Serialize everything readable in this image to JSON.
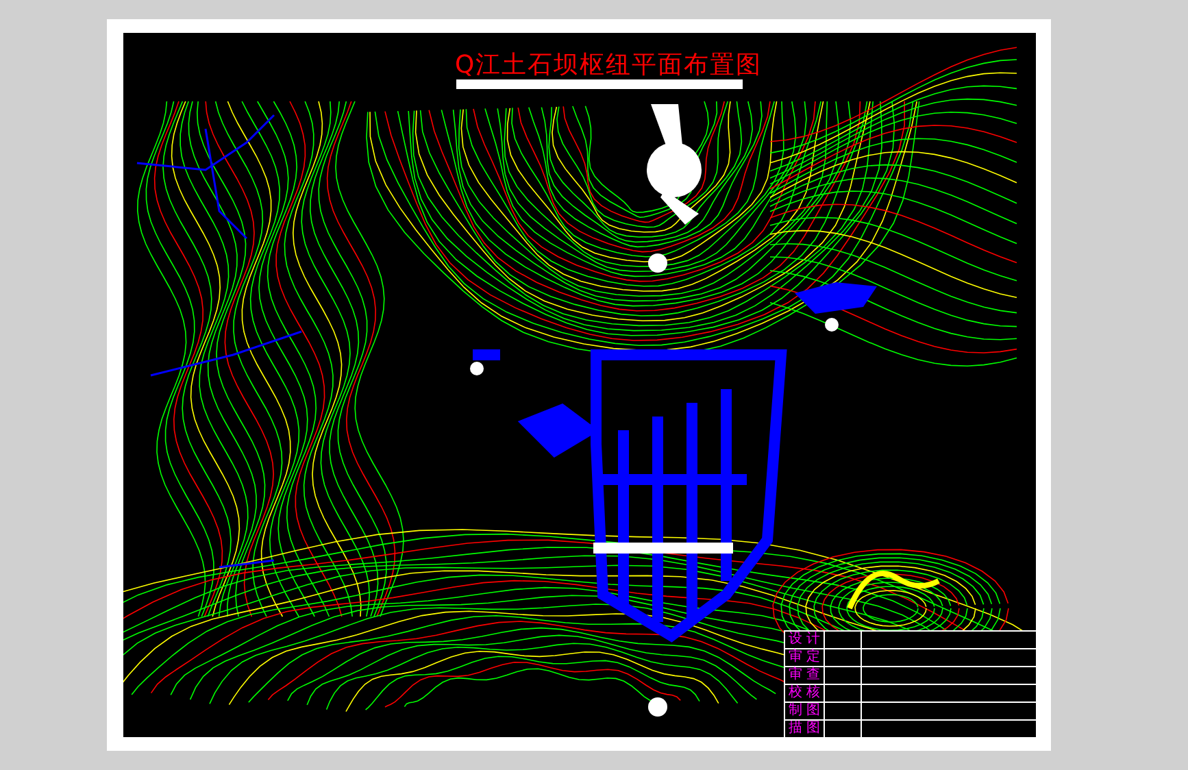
{
  "drawing": {
    "title": "Q江土石坝枢纽平面布置图"
  },
  "title_block": {
    "labels": [
      "设 计",
      "审 定",
      "审 查",
      "校 核",
      "制 图",
      "描 图"
    ]
  }
}
